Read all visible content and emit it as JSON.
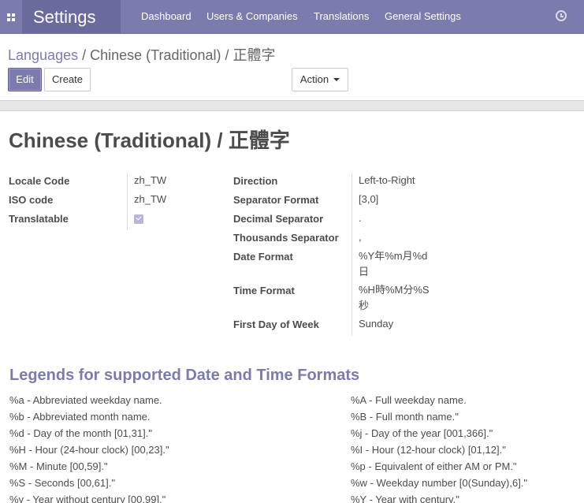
{
  "navbar": {
    "app_title": "Settings",
    "menu": [
      "Dashboard",
      "Users & Companies",
      "Translations",
      "General Settings"
    ]
  },
  "breadcrumb": {
    "parent": "Languages",
    "separator": "/",
    "current": "Chinese (Traditional) / 正體字"
  },
  "buttons": {
    "edit": "Edit",
    "create": "Create",
    "action": "Action"
  },
  "record": {
    "title": "Chinese (Traditional) / 正體字"
  },
  "left_fields": [
    {
      "label": "Locale Code",
      "value": "zh_TW"
    },
    {
      "label": "ISO code",
      "value": "zh_TW"
    },
    {
      "label": "Translatable",
      "value": ""
    }
  ],
  "translatable_checked": true,
  "right_fields": [
    {
      "label": "Direction",
      "value": "Left-to-Right"
    },
    {
      "label": "Separator Format",
      "value": "[3,0]"
    },
    {
      "label": "Decimal Separator",
      "value": "."
    },
    {
      "label": "Thousands Separator",
      "value": ","
    },
    {
      "label": "Date Format",
      "value": "%Y年%m月%d日"
    },
    {
      "label": "Time Format",
      "value": "%H時%M分%S秒"
    },
    {
      "label": "First Day of Week",
      "value": "Sunday"
    }
  ],
  "legend": {
    "title": "Legends for supported Date and Time Formats",
    "left": [
      "%a - Abbreviated weekday name.",
      "%b - Abbreviated month name.",
      "%d - Day of the month [01,31].\"",
      "%H - Hour (24-hour clock) [00,23].\"",
      "%M - Minute [00,59].\"",
      "%S - Seconds [00,61].\"",
      "%y - Year without century [00,99].\""
    ],
    "right": [
      "%A - Full weekday name.",
      "%B - Full month name.\"",
      "%j - Day of the year [001,366].\"",
      "%I - Hour (12-hour clock) [01,12].\"",
      "%p - Equivalent of either AM or PM.\"",
      "%w - Weekday number [0(Sunday),6].\"",
      "%Y - Year with century.\""
    ]
  }
}
